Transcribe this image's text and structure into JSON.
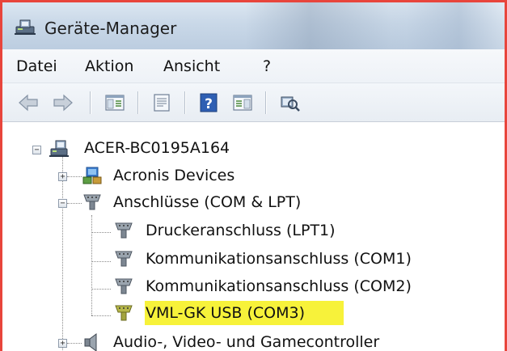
{
  "window": {
    "title": "Geräte-Manager",
    "icon": "device-manager-icon"
  },
  "menu": {
    "items": [
      "Datei",
      "Aktion",
      "Ansicht",
      "?"
    ]
  },
  "toolbar": {
    "buttons": [
      {
        "name": "back-icon"
      },
      {
        "name": "forward-icon"
      },
      {
        "name": "show-hide-console-tree-icon"
      },
      {
        "name": "properties-icon"
      },
      {
        "name": "help-icon"
      },
      {
        "name": "show-action-pane-icon"
      },
      {
        "name": "scan-hardware-icon"
      }
    ]
  },
  "tree": {
    "root": {
      "label": "ACER-BC0195A164",
      "expanded": true,
      "icon": "computer-icon"
    },
    "nodes": [
      {
        "label": "Acronis Devices",
        "expanded": false,
        "icon": "network-device-icon"
      },
      {
        "label": "Anschlüsse (COM & LPT)",
        "expanded": true,
        "icon": "port-icon",
        "children": [
          {
            "label": "Druckeranschluss (LPT1)",
            "icon": "port-icon"
          },
          {
            "label": "Kommunikationsanschluss (COM1)",
            "icon": "port-icon"
          },
          {
            "label": "Kommunikationsanschluss (COM2)",
            "icon": "port-icon"
          },
          {
            "label": "VML-GK USB (COM3)",
            "icon": "port-icon",
            "highlighted": true
          }
        ]
      },
      {
        "label": "Audio-, Video- und Gamecontroller",
        "expanded": false,
        "icon": "speaker-icon"
      }
    ]
  },
  "colors": {
    "frame_border": "#e8453c",
    "highlight": "#f7f23a",
    "titlebar": "#c9d8e8"
  }
}
